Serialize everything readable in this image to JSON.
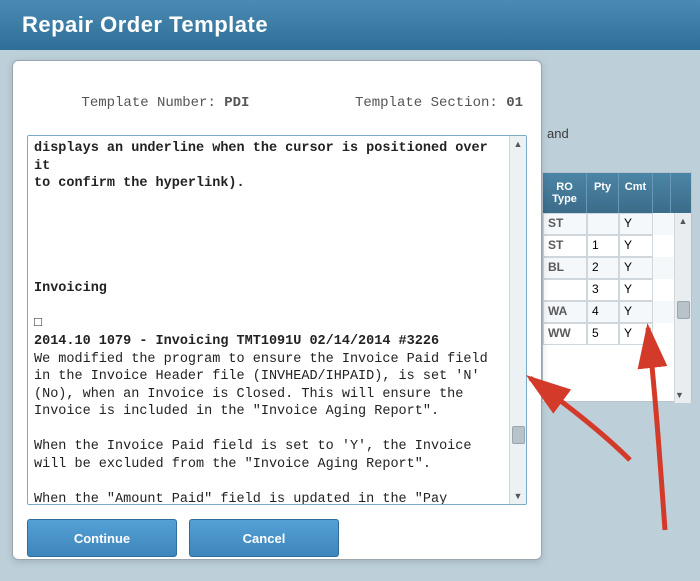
{
  "header": {
    "title": "Repair Order Template"
  },
  "background_fragment": "and",
  "table": {
    "columns": {
      "rotype": "RO Type",
      "pty": "Pty",
      "cmt": "Cmt"
    },
    "rows": [
      {
        "rotype": "ST",
        "pty": "",
        "cmt": "Y"
      },
      {
        "rotype": "ST",
        "pty": "1",
        "cmt": "Y"
      },
      {
        "rotype": "BL",
        "pty": "2",
        "cmt": "Y"
      },
      {
        "rotype": "",
        "pty": "3",
        "cmt": "Y"
      },
      {
        "rotype": "WA",
        "pty": "4",
        "cmt": "Y"
      },
      {
        "rotype": "WW",
        "pty": "5",
        "cmt": "Y"
      }
    ]
  },
  "dialog": {
    "template_number_label": "Template Number: ",
    "template_number_value": "PDI",
    "template_section_label": "Template Section: ",
    "template_section_value": "01",
    "body_lines": [
      "displays an underline when the cursor is positioned over it",
      "to confirm the hyperlink).",
      "",
      "",
      "",
      "",
      "",
      "Invoicing",
      "",
      "□",
      "2014.10 1079 - Invoicing TMT1091U 02/14/2014 #3226",
      "We modified the program to ensure the Invoice Paid field in the Invoice Header file (INVHEAD/IHPAID), is set 'N' (No), when an Invoice is Closed. This will ensure the Invoice is included in the \"Invoice Aging Report\".",
      "",
      "When the Invoice Paid field is set to 'Y', the Invoice will be excluded from the \"Invoice Aging Report\".",
      "",
      "When the \"Amount Paid\" field is updated in the \"Pay Invoice\" window, the \"Amount Paid\" value will be deducted from the"
    ],
    "bold_line_indexes": [
      0,
      1,
      7,
      9,
      10
    ],
    "buttons": {
      "continue": "Continue",
      "cancel": "Cancel"
    }
  }
}
